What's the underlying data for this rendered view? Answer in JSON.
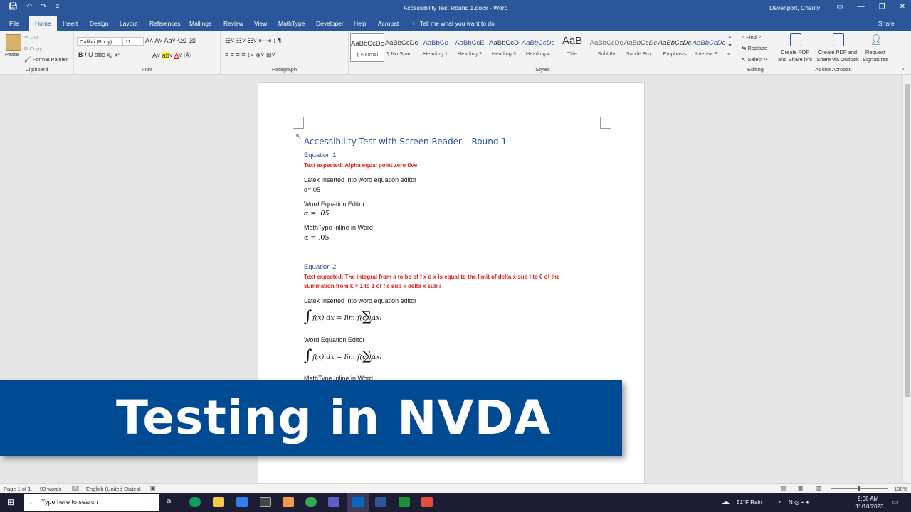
{
  "window": {
    "title": "Accessibility Test Round 1.docx  -  Word",
    "user": "Davenport, Charity",
    "share": "Share"
  },
  "tabs": [
    "File",
    "Home",
    "Insert",
    "Design",
    "Layout",
    "References",
    "Mailings",
    "Review",
    "View",
    "MathType",
    "Developer",
    "Help",
    "Acrobat"
  ],
  "tell_me": "Tell me what you want to do",
  "ribbon": {
    "clipboard": {
      "paste": "Paste",
      "cut": "Cut",
      "copy": "Copy",
      "format_painter": "Format Painter",
      "label": "Clipboard"
    },
    "font": {
      "name": "Calibri (Body)",
      "size": "11",
      "label": "Font"
    },
    "paragraph": {
      "label": "Paragraph"
    },
    "styles": {
      "label": "Styles",
      "items": [
        {
          "preview": "AaBbCcDc",
          "name": "¶ Normal"
        },
        {
          "preview": "AaBbCcDc",
          "name": "¶ No Spac..."
        },
        {
          "preview": "AaBbCc",
          "name": "Heading 1"
        },
        {
          "preview": "AaBbCcE",
          "name": "Heading 2"
        },
        {
          "preview": "AaBbCcD",
          "name": "Heading 3"
        },
        {
          "preview": "AaBbCcDc",
          "name": "Heading 4"
        },
        {
          "preview": "AaB",
          "name": "Title"
        },
        {
          "preview": "AaBbCcDc",
          "name": "Subtitle"
        },
        {
          "preview": "AaBbCcDc",
          "name": "Subtle Em..."
        },
        {
          "preview": "AaBbCcDc",
          "name": "Emphasis"
        },
        {
          "preview": "AaBbCcDc",
          "name": "Intense E..."
        }
      ]
    },
    "editing": {
      "find": "Find",
      "replace": "Replace",
      "select": "Select",
      "label": "Editing"
    },
    "acrobat": {
      "create_pdf": "Create PDF and Share link",
      "create_pdf_outlook": "Create PDF and Share via Outlook",
      "request_sig": "Request Signatures",
      "label": "Adobe Acrobat"
    }
  },
  "document": {
    "title": "Accessibility Test with Screen Reader – Round 1",
    "eq1_heading": "Equation 1",
    "eq1_expected": "Text expected: Alpha equal point zero five",
    "eq1_latex_label": "Latex Inserted into word equation editor",
    "eq1_latex_value": "α=.05",
    "eq1_word_label": "Word Equation Editor",
    "eq1_word_value": "α = .05",
    "eq1_mt_label": "MathType Inline in Word",
    "eq1_mt_value": "α = .05",
    "eq2_heading": "Equation 2",
    "eq2_expected_1": "Text expected: The integral from a to be of f x d x is equal to the limit of delta x sub I to 0 of the",
    "eq2_expected_2": "summation from k = 1 to 1 of f c sub k delta x sub i",
    "eq2_latex_label": "Latex Inserted into word equation editor",
    "eq2_formula": "f(x) dx = lim f(cₖ)Δxᵢ",
    "eq2_word_label": "Word Equation Editor",
    "eq2_mt_label": "MathType Inline in Word"
  },
  "banner": "Testing in NVDA",
  "status": {
    "page": "Page 1 of 1",
    "words": "93 words",
    "language": "English (United States)",
    "zoom": "100%"
  },
  "taskbar": {
    "search": "Type here to search",
    "weather": "51°F  Rain",
    "time": "9:08 AM",
    "date": "11/10/2023"
  }
}
